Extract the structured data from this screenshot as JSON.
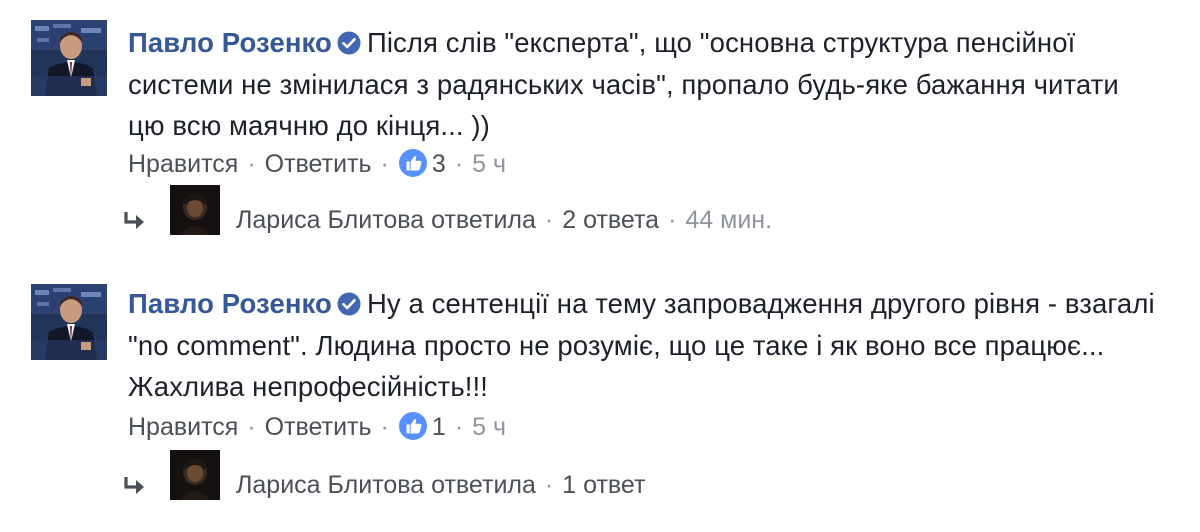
{
  "comments": [
    {
      "author": "Павло Розенко",
      "text": "Після слів \"експерта\", що \"основна структура пенсійної системи не змінилася з радянських часів\", пропало будь-яке бажання читати цю всю маячню до кінця... ))",
      "like_label": "Нравится",
      "reply_label": "Ответить",
      "reaction_count": "3",
      "time": "5 ч",
      "reply_summary": {
        "name_action": "Лариса Блитова ответила",
        "count": "2 ответа",
        "time": "44 мин."
      }
    },
    {
      "author": "Павло Розенко",
      "text": "Ну а сентенції на тему запровадження другого рівня - взагалі \"no comment\". Людина просто не розуміє, що це таке і як воно все працює... Жахлива непрофесійність!!!",
      "like_label": "Нравится",
      "reply_label": "Ответить",
      "reaction_count": "1",
      "time": "5 ч",
      "reply_summary": {
        "name_action": "Лариса Блитова ответила",
        "count": "1 ответ"
      }
    }
  ],
  "icons": {
    "verified": "verified-badge-icon",
    "like": "like-thumb-icon",
    "reply_arrow": "reply-arrow-icon"
  },
  "colors": {
    "author": "#365899",
    "text": "#1d2129",
    "meta": "#90949c",
    "link": "#4b4f56",
    "like_blue": "#5890ff"
  }
}
